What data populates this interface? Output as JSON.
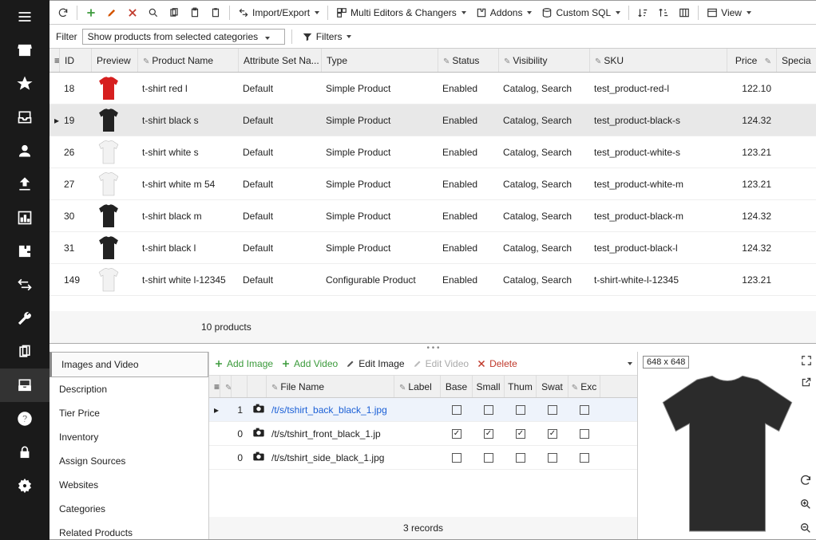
{
  "toolbar": {
    "import_export": "Import/Export",
    "multi_editors": "Multi Editors & Changers",
    "addons": "Addons",
    "custom_sql": "Custom SQL",
    "view": "View"
  },
  "filter": {
    "label": "Filter",
    "select_text": "Show products from selected categories",
    "filters_label": "Filters"
  },
  "columns": {
    "id": "ID",
    "preview": "Preview",
    "product_name": "Product Name",
    "attr_set": "Attribute Set Na...",
    "type": "Type",
    "status": "Status",
    "visibility": "Visibility",
    "sku": "SKU",
    "price": "Price",
    "special": "Specia"
  },
  "rows": [
    {
      "id": "18",
      "name": "t-shirt  red l",
      "attr": "Default",
      "type": "Simple Product",
      "status": "Enabled",
      "vis": "Catalog, Search",
      "sku": "test_product-red-l",
      "price": "122.10",
      "color": "#d61f1f"
    },
    {
      "id": "19",
      "name": "t-shirt  black s",
      "attr": "Default",
      "type": "Simple Product",
      "status": "Enabled",
      "vis": "Catalog, Search",
      "sku": "test_product-black-s",
      "price": "124.32",
      "color": "#222",
      "selected": true
    },
    {
      "id": "26",
      "name": "t-shirt  white s",
      "attr": "Default",
      "type": "Simple Product",
      "status": "Enabled",
      "vis": "Catalog, Search",
      "sku": "test_product-white-s",
      "price": "123.21",
      "color": "#f2f2f2"
    },
    {
      "id": "27",
      "name": "t-shirt  white m 54",
      "attr": "Default",
      "type": "Simple Product",
      "status": "Enabled",
      "vis": "Catalog, Search",
      "sku": "test_product-white-m",
      "price": "123.21",
      "color": "#f2f2f2"
    },
    {
      "id": "30",
      "name": "t-shirt  black m",
      "attr": "Default",
      "type": "Simple Product",
      "status": "Enabled",
      "vis": "Catalog, Search",
      "sku": "test_product-black-m",
      "price": "124.32",
      "color": "#222"
    },
    {
      "id": "31",
      "name": "t-shirt  black l",
      "attr": "Default",
      "type": "Simple Product",
      "status": "Enabled",
      "vis": "Catalog, Search",
      "sku": "test_product-black-l",
      "price": "124.32",
      "color": "#222"
    },
    {
      "id": "149",
      "name": "t-shirt  white l-12345",
      "attr": "Default",
      "type": "Configurable Product",
      "status": "Enabled",
      "vis": "Catalog, Search",
      "sku": "t-shirt-white-l-12345",
      "price": "123.21",
      "color": "#f2f2f2"
    }
  ],
  "grid_footer": "10 products",
  "tabs": [
    "Images and Video",
    "Description",
    "Tier Price",
    "Inventory",
    "Assign Sources",
    "Websites",
    "Categories",
    "Related Products"
  ],
  "image_actions": {
    "add_image": "Add Image",
    "add_video": "Add Video",
    "edit_image": "Edit Image",
    "edit_video": "Edit Video",
    "delete": "Delete"
  },
  "image_columns": {
    "filename": "File Name",
    "label": "Label",
    "base": "Base",
    "small": "Small",
    "thum": "Thum",
    "swat": "Swat",
    "exc": "Exc"
  },
  "image_rows": [
    {
      "idx": "1",
      "file": "/t/s/tshirt_back_black_1.jpg",
      "label": "",
      "base": false,
      "small": false,
      "thum": false,
      "swat": false,
      "exc": false,
      "selected": true,
      "link": true
    },
    {
      "idx": "0",
      "file": "/t/s/tshirt_front_black_1.jp",
      "label": "",
      "base": true,
      "small": true,
      "thum": true,
      "swat": true,
      "exc": false
    },
    {
      "idx": "0",
      "file": "/t/s/tshirt_side_black_1.jpg",
      "label": "",
      "base": false,
      "small": false,
      "thum": false,
      "swat": false,
      "exc": false
    }
  ],
  "image_footer": "3 records",
  "preview": {
    "dimensions": "648 x 648",
    "tshirt_color": "#2b2b2b"
  }
}
